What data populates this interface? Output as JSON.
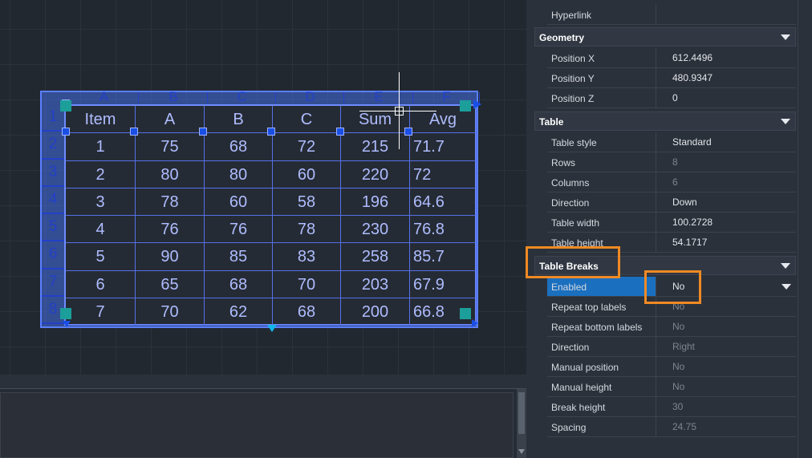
{
  "table": {
    "column_letters": [
      "A",
      "B",
      "C",
      "D",
      "E",
      "F"
    ],
    "row_numbers": [
      "1",
      "2",
      "3",
      "4",
      "5",
      "6",
      "7",
      "8"
    ],
    "rows": [
      [
        "Item",
        "A",
        "B",
        "C",
        "Sum",
        "Avg"
      ],
      [
        "1",
        "75",
        "68",
        "72",
        "215",
        "71.7"
      ],
      [
        "2",
        "80",
        "80",
        "60",
        "220",
        "72"
      ],
      [
        "3",
        "78",
        "60",
        "58",
        "196",
        "64.6"
      ],
      [
        "4",
        "76",
        "76",
        "78",
        "230",
        "76.8"
      ],
      [
        "5",
        "90",
        "85",
        "83",
        "258",
        "85.7"
      ],
      [
        "6",
        "65",
        "68",
        "70",
        "203",
        "67.9"
      ],
      [
        "7",
        "70",
        "62",
        "68",
        "200",
        "66.8"
      ]
    ]
  },
  "properties": {
    "top_row": {
      "label": "Hyperlink",
      "value": ""
    },
    "geometry": {
      "title": "Geometry",
      "rows": [
        {
          "label": "Position X",
          "value": "612.4496",
          "dim": false
        },
        {
          "label": "Position Y",
          "value": "480.9347",
          "dim": false
        },
        {
          "label": "Position Z",
          "value": "0",
          "dim": false
        }
      ]
    },
    "table": {
      "title": "Table",
      "rows": [
        {
          "label": "Table style",
          "value": "Standard",
          "dim": false
        },
        {
          "label": "Rows",
          "value": "8",
          "dim": true
        },
        {
          "label": "Columns",
          "value": "6",
          "dim": true
        },
        {
          "label": "Direction",
          "value": "Down",
          "dim": false
        },
        {
          "label": "Table width",
          "value": "100.2728",
          "dim": false
        },
        {
          "label": "Table height",
          "value": "54.1717",
          "dim": false
        }
      ]
    },
    "breaks": {
      "title": "Table Breaks",
      "enabled": {
        "label": "Enabled",
        "value": "No"
      },
      "rows": [
        {
          "label": "Repeat top labels",
          "value": "No",
          "dim": true
        },
        {
          "label": "Repeat bottom labels",
          "value": "No",
          "dim": true
        },
        {
          "label": "Direction",
          "value": "Right",
          "dim": true
        },
        {
          "label": "Manual position",
          "value": "No",
          "dim": true
        },
        {
          "label": "Manual height",
          "value": "No",
          "dim": true
        },
        {
          "label": "Break height",
          "value": "30",
          "dim": true
        },
        {
          "label": "Spacing",
          "value": "24.75",
          "dim": true
        }
      ]
    }
  },
  "colors": {
    "highlight": "#f08a23",
    "selected_row": "#1b6fbf",
    "table_overlay": "#466ee6"
  },
  "icons": [
    "dropdown-arrow-icon",
    "crosshair-cursor-icon",
    "grip-icon"
  ]
}
